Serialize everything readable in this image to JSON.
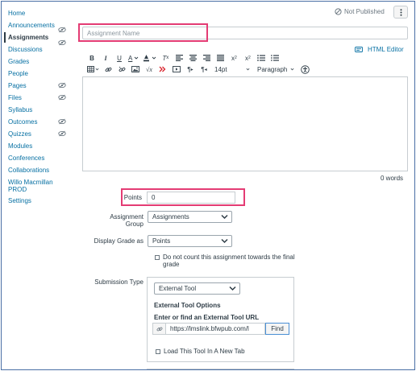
{
  "sidebar": {
    "items": [
      {
        "label": "Home"
      },
      {
        "label": "Announcements",
        "hidden": true
      },
      {
        "label": "Assignments",
        "active": true,
        "hidden": true
      },
      {
        "label": "Discussions"
      },
      {
        "label": "Grades"
      },
      {
        "label": "People"
      },
      {
        "label": "Pages",
        "hidden": true
      },
      {
        "label": "Files",
        "hidden": true
      },
      {
        "label": "Syllabus"
      },
      {
        "label": "Outcomes",
        "hidden": true
      },
      {
        "label": "Quizzes",
        "hidden": true
      },
      {
        "label": "Modules"
      },
      {
        "label": "Conferences"
      },
      {
        "label": "Collaborations"
      },
      {
        "label": "Willo Macmillan PROD"
      },
      {
        "label": "Settings"
      }
    ]
  },
  "header": {
    "status": "Not Published",
    "status_icon": "not-published-icon",
    "menu_icon": "kebab-icon"
  },
  "assignment": {
    "name_value": "",
    "name_placeholder": "Assignment Name"
  },
  "editor": {
    "html_editor_label": "HTML Editor",
    "font_size": "14pt",
    "block_format": "Paragraph",
    "word_count": "0 words",
    "toolbar_icons": [
      "bold-icon",
      "italic-icon",
      "underline-icon",
      "text-color-icon",
      "background-color-icon",
      "clear-formatting-icon",
      "align-left-icon",
      "align-center-icon",
      "align-right-icon",
      "align-justify-icon",
      "superscript-icon",
      "subscript-icon",
      "bullet-list-icon",
      "numbered-list-icon",
      "table-icon",
      "link-icon",
      "unlink-icon",
      "image-icon",
      "math-icon",
      "media-icon",
      "embed-icon",
      "ltr-icon",
      "rtl-icon",
      "accessibility-icon"
    ]
  },
  "form": {
    "points_label": "Points",
    "points_value": "0",
    "group_label": "Assignment Group",
    "group_value": "Assignments",
    "display_label": "Display Grade as",
    "display_value": "Points",
    "final_grade_checkbox": "Do not count this assignment towards the final grade",
    "final_grade_checked": false,
    "submission_label": "Submission Type",
    "submission_value": "External Tool",
    "ext_title": "External Tool Options",
    "ext_url_label": "Enter or find an External Tool URL",
    "ext_url_value": "https://lmslink.bfwpub.com/l",
    "find_label": "Find",
    "new_tab_label": "Load This Tool In A New Tab",
    "new_tab_checked": false
  },
  "colors": {
    "link": "#0770a3",
    "highlight": "#e43c74",
    "text": "#2d3b45"
  }
}
